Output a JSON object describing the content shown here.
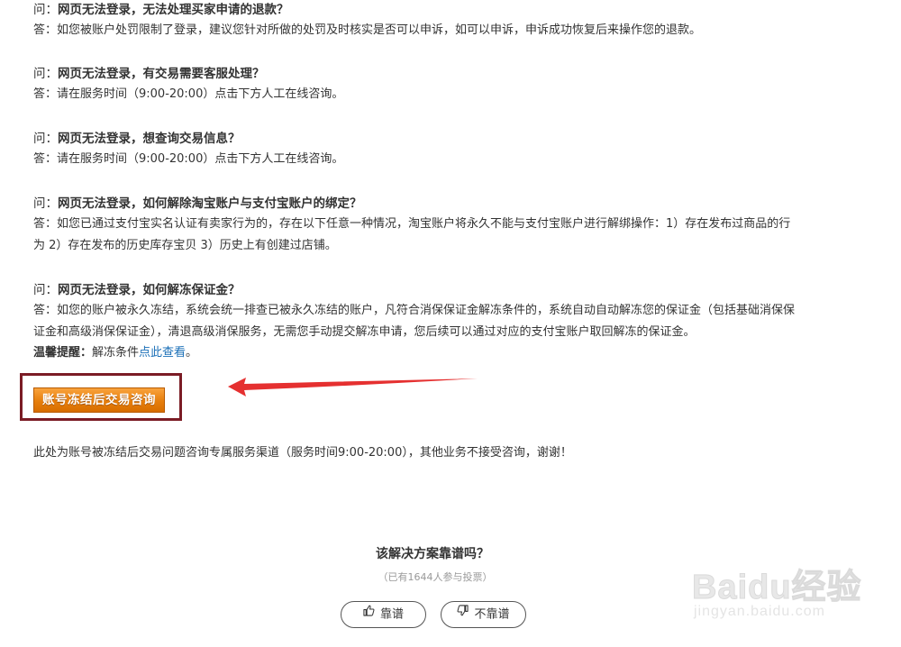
{
  "faq": [
    {
      "q_prefix": "问：",
      "q_title": "网页无法登录，无法处理买家申请的退款？",
      "a_lines": [
        "答：如您被账户处罚限制了登录，建议您针对所做的处罚及时核实是否可以申诉，如可以申诉，申诉成功恢复后来操作您的退款。"
      ]
    },
    {
      "q_prefix": "问：",
      "q_title": "网页无法登录，有交易需要客服处理？",
      "a_lines": [
        "答：请在服务时间（9:00-20:00）点击下方人工在线咨询。"
      ]
    },
    {
      "q_prefix": "问：",
      "q_title": "网页无法登录，想查询交易信息？",
      "a_lines": [
        "答：请在服务时间（9:00-20:00）点击下方人工在线咨询。"
      ]
    },
    {
      "q_prefix": "问：",
      "q_title": "网页无法登录，如何解除淘宝账户与支付宝账户的绑定？",
      "a_lines": [
        "答：如您已通过支付宝实名认证有卖家行为的，存在以下任意一种情况，淘宝账户将永久不能与支付宝账户进行解绑操作：1）存在发布过商品的行",
        "为 2）存在发布的历史库存宝贝 3）历史上有创建过店铺。"
      ]
    },
    {
      "q_prefix": "问：",
      "q_title": "网页无法登录，如何解冻保证金？",
      "a_lines": [
        "答：如您的账户被永久冻结，系统会统一排查已被永久冻结的账户，凡符合消保保证金解冻条件的，系统自动自动解冻您的保证金（包括基础消保保",
        "证金和高级消保保证金），清退高级消保服务，无需您手动提交解冻申请，您后续可以通过对应的支付宝账户取回解冻的保证金。"
      ]
    }
  ],
  "tip": {
    "label": "温馨提醒：",
    "text": "解冻条件",
    "link": "点此查看",
    "suffix": "。"
  },
  "cta": {
    "label": "账号冻结后交易咨询"
  },
  "channel_note": "此处为账号被冻结后交易问题咨询专属服务渠道（服务时间9:00-20:00），其他业务不接受咨询，谢谢！",
  "vote": {
    "title": "该解决方案靠谱吗？",
    "count_text": "（已有1644人参与投票）",
    "up_label": "靠谱",
    "down_label": "不靠谱",
    "up_icon": "thumbs-up-icon",
    "down_icon": "thumbs-down-icon"
  },
  "watermark": {
    "brand": "Baidu经验",
    "url": "jingyan.baidu.com"
  },
  "colors": {
    "cta_orange": "#e67e0c",
    "frame_maroon": "#7b1c25",
    "arrow_red": "#e53030",
    "link_blue": "#1a6fb7"
  }
}
